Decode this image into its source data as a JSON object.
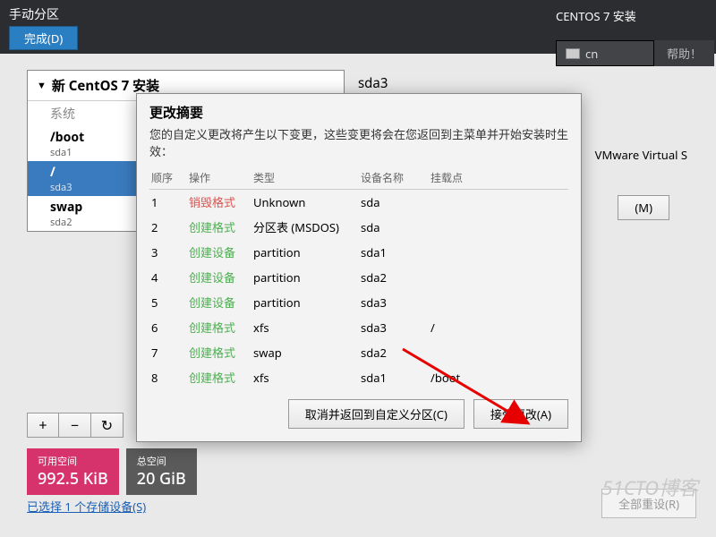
{
  "header": {
    "title": "手动分区",
    "done": "完成(D)",
    "install_label": "CENTOS 7 安装",
    "lang": "cn",
    "help": "帮助！"
  },
  "left": {
    "expand": "新 CentOS 7 安装",
    "section": "系统",
    "items": [
      {
        "name": "/boot",
        "dev": "sda1"
      },
      {
        "name": "/",
        "dev": "sda3"
      },
      {
        "name": "swap",
        "dev": "sda2"
      }
    ]
  },
  "right": {
    "device": "sda3",
    "vmware": "VMware Virtual S",
    "modify": "(M)"
  },
  "toolbar": {
    "plus": "+",
    "minus": "−",
    "reload": "↻"
  },
  "space": {
    "avail_label": "可用空间",
    "avail_value": "992.5 KiB",
    "total_label": "总空间",
    "total_value": "20 GiB"
  },
  "storage_link": "已选择 1 个存储设备(S)",
  "reset_all": "全部重设(R)",
  "dialog": {
    "title": "更改摘要",
    "message": "您的自定义更改将产生以下变更，这些变更将会在您返回到主菜单并开始安装时生效：",
    "headers": {
      "order": "顺序",
      "action": "操作",
      "type": "类型",
      "devname": "设备名称",
      "mount": "挂载点"
    },
    "rows": [
      {
        "order": "1",
        "action": "销毁格式",
        "cls": "op-destroy",
        "type": "Unknown",
        "dev": "sda",
        "mount": ""
      },
      {
        "order": "2",
        "action": "创建格式",
        "cls": "op-create",
        "type": "分区表 (MSDOS)",
        "dev": "sda",
        "mount": ""
      },
      {
        "order": "3",
        "action": "创建设备",
        "cls": "op-create",
        "type": "partition",
        "dev": "sda1",
        "mount": ""
      },
      {
        "order": "4",
        "action": "创建设备",
        "cls": "op-create",
        "type": "partition",
        "dev": "sda2",
        "mount": ""
      },
      {
        "order": "5",
        "action": "创建设备",
        "cls": "op-create",
        "type": "partition",
        "dev": "sda3",
        "mount": ""
      },
      {
        "order": "6",
        "action": "创建格式",
        "cls": "op-create",
        "type": "xfs",
        "dev": "sda3",
        "mount": "/"
      },
      {
        "order": "7",
        "action": "创建格式",
        "cls": "op-create",
        "type": "swap",
        "dev": "sda2",
        "mount": ""
      },
      {
        "order": "8",
        "action": "创建格式",
        "cls": "op-create",
        "type": "xfs",
        "dev": "sda1",
        "mount": "/boot"
      }
    ],
    "cancel": "取消并返回到自定义分区(C)",
    "accept": "接受更改(A)"
  },
  "watermark": "51CTO博客"
}
